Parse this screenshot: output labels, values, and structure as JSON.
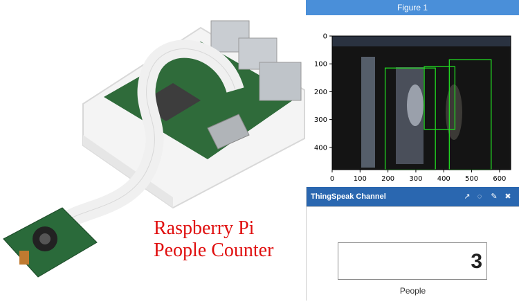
{
  "caption": {
    "line1": "Raspberry Pi",
    "line2": "People Counter"
  },
  "colors": {
    "caption": "#e01010",
    "figure_titlebar": "#4a8fd9",
    "thingspeak_header": "#2a67b0",
    "detection_box": "#22dd22"
  },
  "figure_window": {
    "title": "Figure 1",
    "plot": {
      "x_ticks": [
        "0",
        "100",
        "200",
        "300",
        "400",
        "500",
        "600"
      ],
      "y_ticks": [
        "0",
        "100",
        "200",
        "300",
        "400"
      ],
      "xlim": [
        0,
        640
      ],
      "ylim": [
        480,
        0
      ],
      "detections": [
        {
          "x0": 190,
          "y0": 115,
          "x1": 370,
          "y1": 480
        },
        {
          "x0": 330,
          "y0": 110,
          "x1": 440,
          "y1": 335
        },
        {
          "x0": 420,
          "y0": 85,
          "x1": 570,
          "y1": 480
        }
      ]
    }
  },
  "thingspeak": {
    "title": "ThingSpeak Channel",
    "icons": [
      "external-link-icon",
      "comment-icon",
      "edit-icon",
      "close-icon"
    ],
    "value": "3",
    "field_label": "People"
  }
}
